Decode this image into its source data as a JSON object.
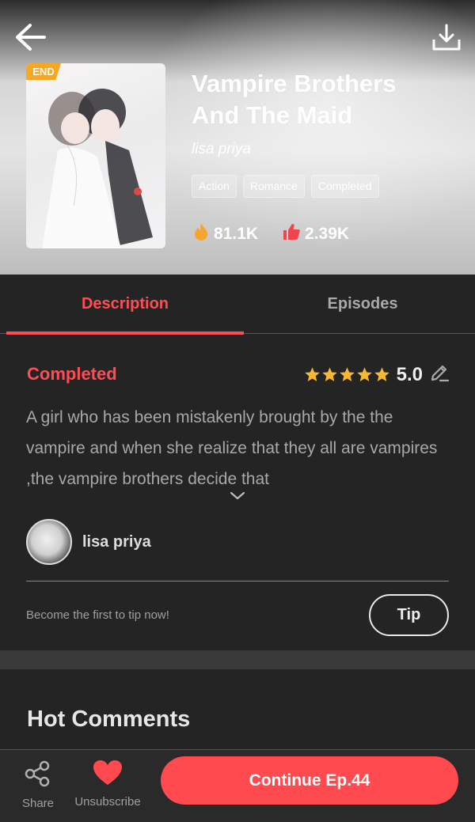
{
  "colors": {
    "accent": "#ff4d55",
    "badge": "#f6a823",
    "background": "#242424"
  },
  "book": {
    "badge": "END",
    "title": "Vampire Brothers And The Maid",
    "author": "lisa priya",
    "genres": [
      "Action",
      "Romance",
      "Completed"
    ],
    "views": "81.1K",
    "likes": "2.39K"
  },
  "tabs": {
    "description": "Description",
    "episodes": "Episodes"
  },
  "description": {
    "status": "Completed",
    "rating_value": "5.0",
    "stars": 5,
    "text": "A girl who has been mistakenly brought by the the vampire and when she realize that they all are vampires ,the vampire brothers decide that"
  },
  "author": {
    "name": "lisa priya"
  },
  "tip": {
    "prompt": "Become the first to tip now!",
    "button": "Tip"
  },
  "comments": {
    "heading": "Hot Comments"
  },
  "bottom_bar": {
    "share": "Share",
    "unsubscribe": "Unsubscribe",
    "continue": "Continue Ep.44"
  },
  "icons": [
    "back-arrow-icon",
    "download-icon",
    "fire-icon",
    "thumbs-up-icon",
    "star-icon",
    "pencil-icon",
    "chevron-down-icon",
    "share-icon",
    "heart-icon"
  ]
}
